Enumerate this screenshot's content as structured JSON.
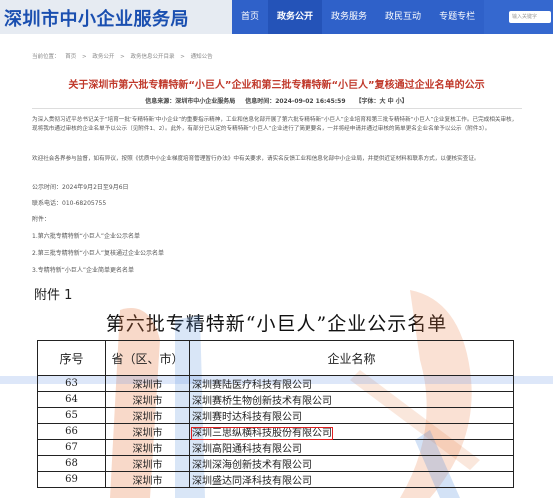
{
  "header": {
    "site_title": "深圳市中小企业服务局",
    "nav": [
      "首页",
      "政务公开",
      "政务服务",
      "政民互动",
      "专题专栏"
    ],
    "active_nav": "政务公开",
    "search_placeholder": "输入关键字"
  },
  "breadcrumb": [
    "当前位置：",
    "首页",
    ">",
    "政务公开",
    ">",
    "政务信息公开目录",
    ">",
    "通知公告"
  ],
  "article": {
    "title": "关于深圳市第六批专精特新“小巨人”企业和第三批专精特新“小巨人”复核通过企业名单的公示",
    "source": "信息来源：深圳市中小企业服务局",
    "time": "信息时间：2024-09-02 16:45:59",
    "font_size_label": "【字体：",
    "font_sizes": [
      "大",
      "中",
      "小"
    ],
    "font_size_end": "】",
    "paragraphs": [
      "为深入贯彻习近平总书记关于“培育一批‘专精特新’中小企业”的重要指示精神，工业和信息化部开展了第六批专精特新“小巨人”企业培育和第三批专精特新“小巨人”企业复核工作。已完成相关审核，现将我市通过审核的企业名单予以公示（见附件1、2）。此外，有部分已认定的专精特新“小巨人”企业进行了简更要名，一并将经申请并通过审核的简单更名企业名单予以公示（附件3）。",
      "欢迎社会各界参与监督，如有异议，按照《优质中小企业梯度培育管理暂行办法》中有关要求，请实名反馈工业和信息化部中小企业局，并提供近证材料和联系方式，以便核实查证。"
    ],
    "period": "公示时间：2024年9月2日至9月6日",
    "phone": "联系电话：010-68205755",
    "attachments_label": "附件：",
    "attachments": [
      "1.第六批专精特新“小巨人”企业公示名单",
      "2.第三批专精特新“小巨人”复核通过企业公示名单",
      "3.专精特新“小巨人”企业简单更名名单"
    ]
  },
  "attachment_image": {
    "label": "附件 1",
    "doc_title": "第六批专精特新“小巨人”企业公示名单",
    "table": {
      "headers": [
        "序号",
        "省（区、市）",
        "企业名称"
      ],
      "rows": [
        [
          "63",
          "深圳市",
          "深圳赛陆医疗科技有限公司"
        ],
        [
          "64",
          "深圳市",
          "深圳赛桥生物创新技术有限公司"
        ],
        [
          "65",
          "深圳市",
          "深圳赛时达科技有限公司"
        ],
        [
          "66",
          "深圳市",
          "深圳三思纵横科技股份有限公司"
        ],
        [
          "67",
          "深圳市",
          "深圳高阳通科技有限公司"
        ],
        [
          "68",
          "深圳市",
          "深圳深海创新技术有限公司"
        ],
        [
          "69",
          "深圳市",
          "深圳盛达同泽科技有限公司"
        ]
      ],
      "highlighted_row": "66"
    }
  },
  "colors": {
    "brand_blue": "#1a4fb0",
    "nav_blue": "#3568cf",
    "title_red": "#c0392b",
    "highlight_red": "#e02020"
  }
}
